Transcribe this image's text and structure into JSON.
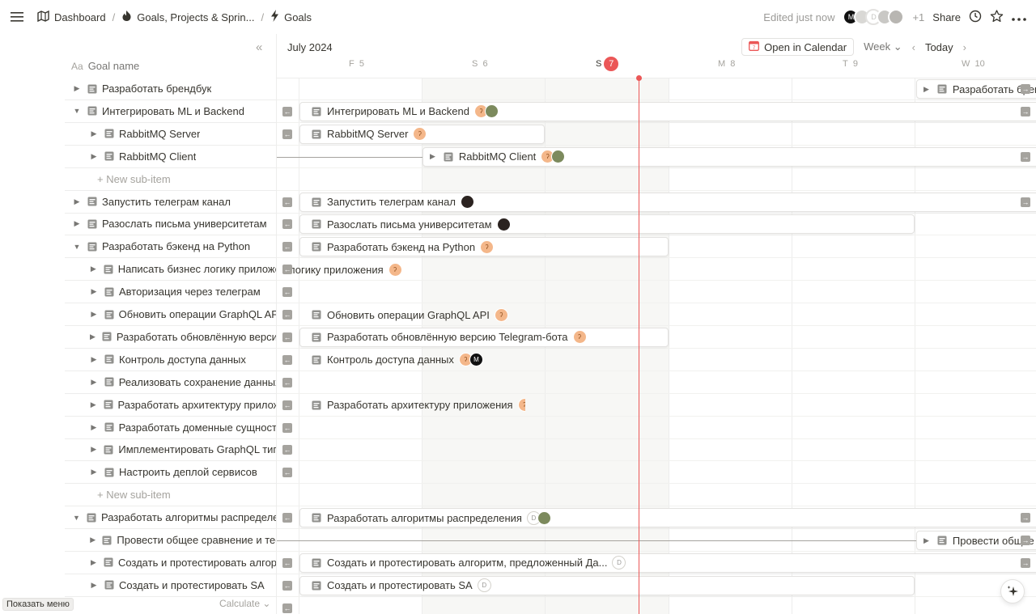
{
  "topbar": {
    "breadcrumbs": [
      {
        "label": "Dashboard",
        "icon": "roadmap-icon"
      },
      {
        "label": "Goals, Projects & Sprin...",
        "icon": "fire-icon"
      },
      {
        "label": "Goals",
        "icon": "bolt-icon"
      }
    ],
    "edited": "Edited just now",
    "extra_count": "+1",
    "share": "Share"
  },
  "left": {
    "column_header_prefix": "Aa",
    "column_header": "Goal name",
    "rows": [
      {
        "label": "Разработать брендбук",
        "level": 0,
        "toggle": "▶"
      },
      {
        "label": "Интегрировать ML и Backend",
        "level": 0,
        "toggle": "▼"
      },
      {
        "label": "RabbitMQ Server",
        "level": 1,
        "toggle": "▶"
      },
      {
        "label": "RabbitMQ Client",
        "level": 1,
        "toggle": "▶"
      },
      {
        "label": "New sub-item",
        "level": 1,
        "newsub": true
      },
      {
        "label": "Запустить телеграм канал",
        "level": 0,
        "toggle": "▶"
      },
      {
        "label": "Разослать письма университетам",
        "level": 0,
        "toggle": "▶"
      },
      {
        "label": "Разработать бэкенд на Python",
        "level": 0,
        "toggle": "▼"
      },
      {
        "label": "Написать бизнес логику приложения",
        "level": 1,
        "toggle": "▶"
      },
      {
        "label": "Авторизация через телеграм",
        "level": 1,
        "toggle": "▶"
      },
      {
        "label": "Обновить операции GraphQL API",
        "level": 1,
        "toggle": "▶"
      },
      {
        "label": "Разработать обновлённую версию Telegram-бота",
        "level": 1,
        "toggle": "▶"
      },
      {
        "label": "Контроль доступа данных",
        "level": 1,
        "toggle": "▶"
      },
      {
        "label": "Реализовать сохранение данных",
        "level": 1,
        "toggle": "▶"
      },
      {
        "label": "Разработать архитектуру приложения",
        "level": 1,
        "toggle": "▶"
      },
      {
        "label": "Разработать доменные сущности",
        "level": 1,
        "toggle": "▶"
      },
      {
        "label": "Имплементировать GraphQL типы",
        "level": 1,
        "toggle": "▶"
      },
      {
        "label": "Настроить деплой сервисов",
        "level": 1,
        "toggle": "▶"
      },
      {
        "label": "New sub-item",
        "level": 1,
        "newsub": true
      },
      {
        "label": "Разработать алгоритмы распределения",
        "level": 0,
        "toggle": "▼"
      },
      {
        "label": "Провести общее сравнение и тестирование",
        "level": 1,
        "toggle": "▶"
      },
      {
        "label": "Создать и протестировать алгоритм",
        "level": 1,
        "toggle": "▶"
      },
      {
        "label": "Создать и протестировать SA",
        "level": 1,
        "toggle": "▶"
      }
    ],
    "new_sub_plus": "+",
    "show_menu": "Показать меню",
    "calculate": "Calculate"
  },
  "timeline": {
    "month": "July 2024",
    "open_in_calendar": "Open in Calendar",
    "range": "Week",
    "today": "Today",
    "days": [
      {
        "letter": "F",
        "num": "5"
      },
      {
        "letter": "S",
        "num": "6"
      },
      {
        "letter": "S",
        "num": "7",
        "today": true
      },
      {
        "letter": "M",
        "num": "8"
      },
      {
        "letter": "T",
        "num": "9"
      },
      {
        "letter": "W",
        "num": "10"
      }
    ],
    "bars": {
      "b0": "Разработать брендбук",
      "b1": "Интегрировать ML и Backend",
      "b2": "RabbitMQ Server",
      "b3": "RabbitMQ Client",
      "b5": "Запустить телеграм канал",
      "b6": "Разослать письма университетам",
      "b7": "Разработать бэкенд на Python",
      "b8": "логику приложения",
      "b10": "Обновить операции GraphQL API",
      "b11": "Разработать обновлённую версию Telegram-бота",
      "b12": "Контроль доступа данных",
      "b14": "Разработать архитектуру приложения",
      "b19": "Разработать алгоритмы распределения",
      "b20": "Провести общее с",
      "b21": "Создать и протестировать алгоритм, предложенный Да...",
      "b22": "Создать и протестировать SA"
    },
    "avatar_letter": "D"
  },
  "colors": {
    "accent_red": "#eb5757",
    "text": "#37352f",
    "muted": "#a5a39e",
    "weekend_shade": "#f7f7f5"
  }
}
